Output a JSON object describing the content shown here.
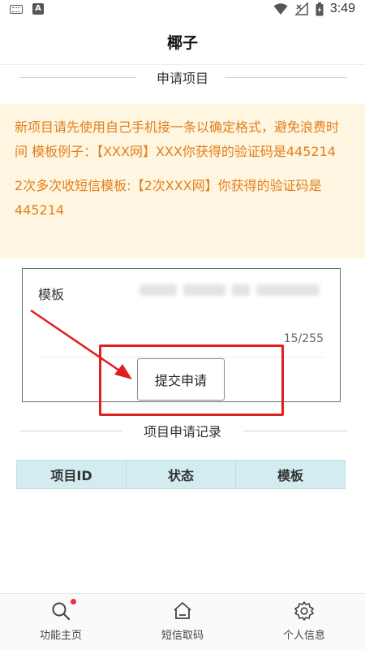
{
  "status_bar": {
    "time": "3:49"
  },
  "header": {
    "title": "椰子"
  },
  "apply_section": {
    "title": "申请项目"
  },
  "notice": {
    "line1": "新项目请先使用自己手机接一条以确定格式，避免浪费时间 模板例子：【XXX网】XXX你获得的验证码是445214",
    "line2": "2次多次收短信模板:【2次XXX网】你获得的验证码是445214"
  },
  "form": {
    "template_label": "模板",
    "char_count": "15/255",
    "submit_label": "提交申请"
  },
  "records_section": {
    "title": "项目申请记录"
  },
  "records_table": {
    "columns": [
      "项目ID",
      "状态",
      "模板"
    ]
  },
  "bottom_nav": {
    "items": [
      {
        "label": "功能主页",
        "icon": "search-icon",
        "has_badge": true
      },
      {
        "label": "短信取码",
        "icon": "home-icon",
        "has_badge": false
      },
      {
        "label": "个人信息",
        "icon": "gear-icon",
        "has_badge": false
      }
    ]
  },
  "colors": {
    "notice_text": "#e27f1a",
    "notice_bg": "#fff6e2",
    "table_header_bg": "#d3ecef",
    "highlight": "#e02020",
    "badge": "#e8303a"
  }
}
